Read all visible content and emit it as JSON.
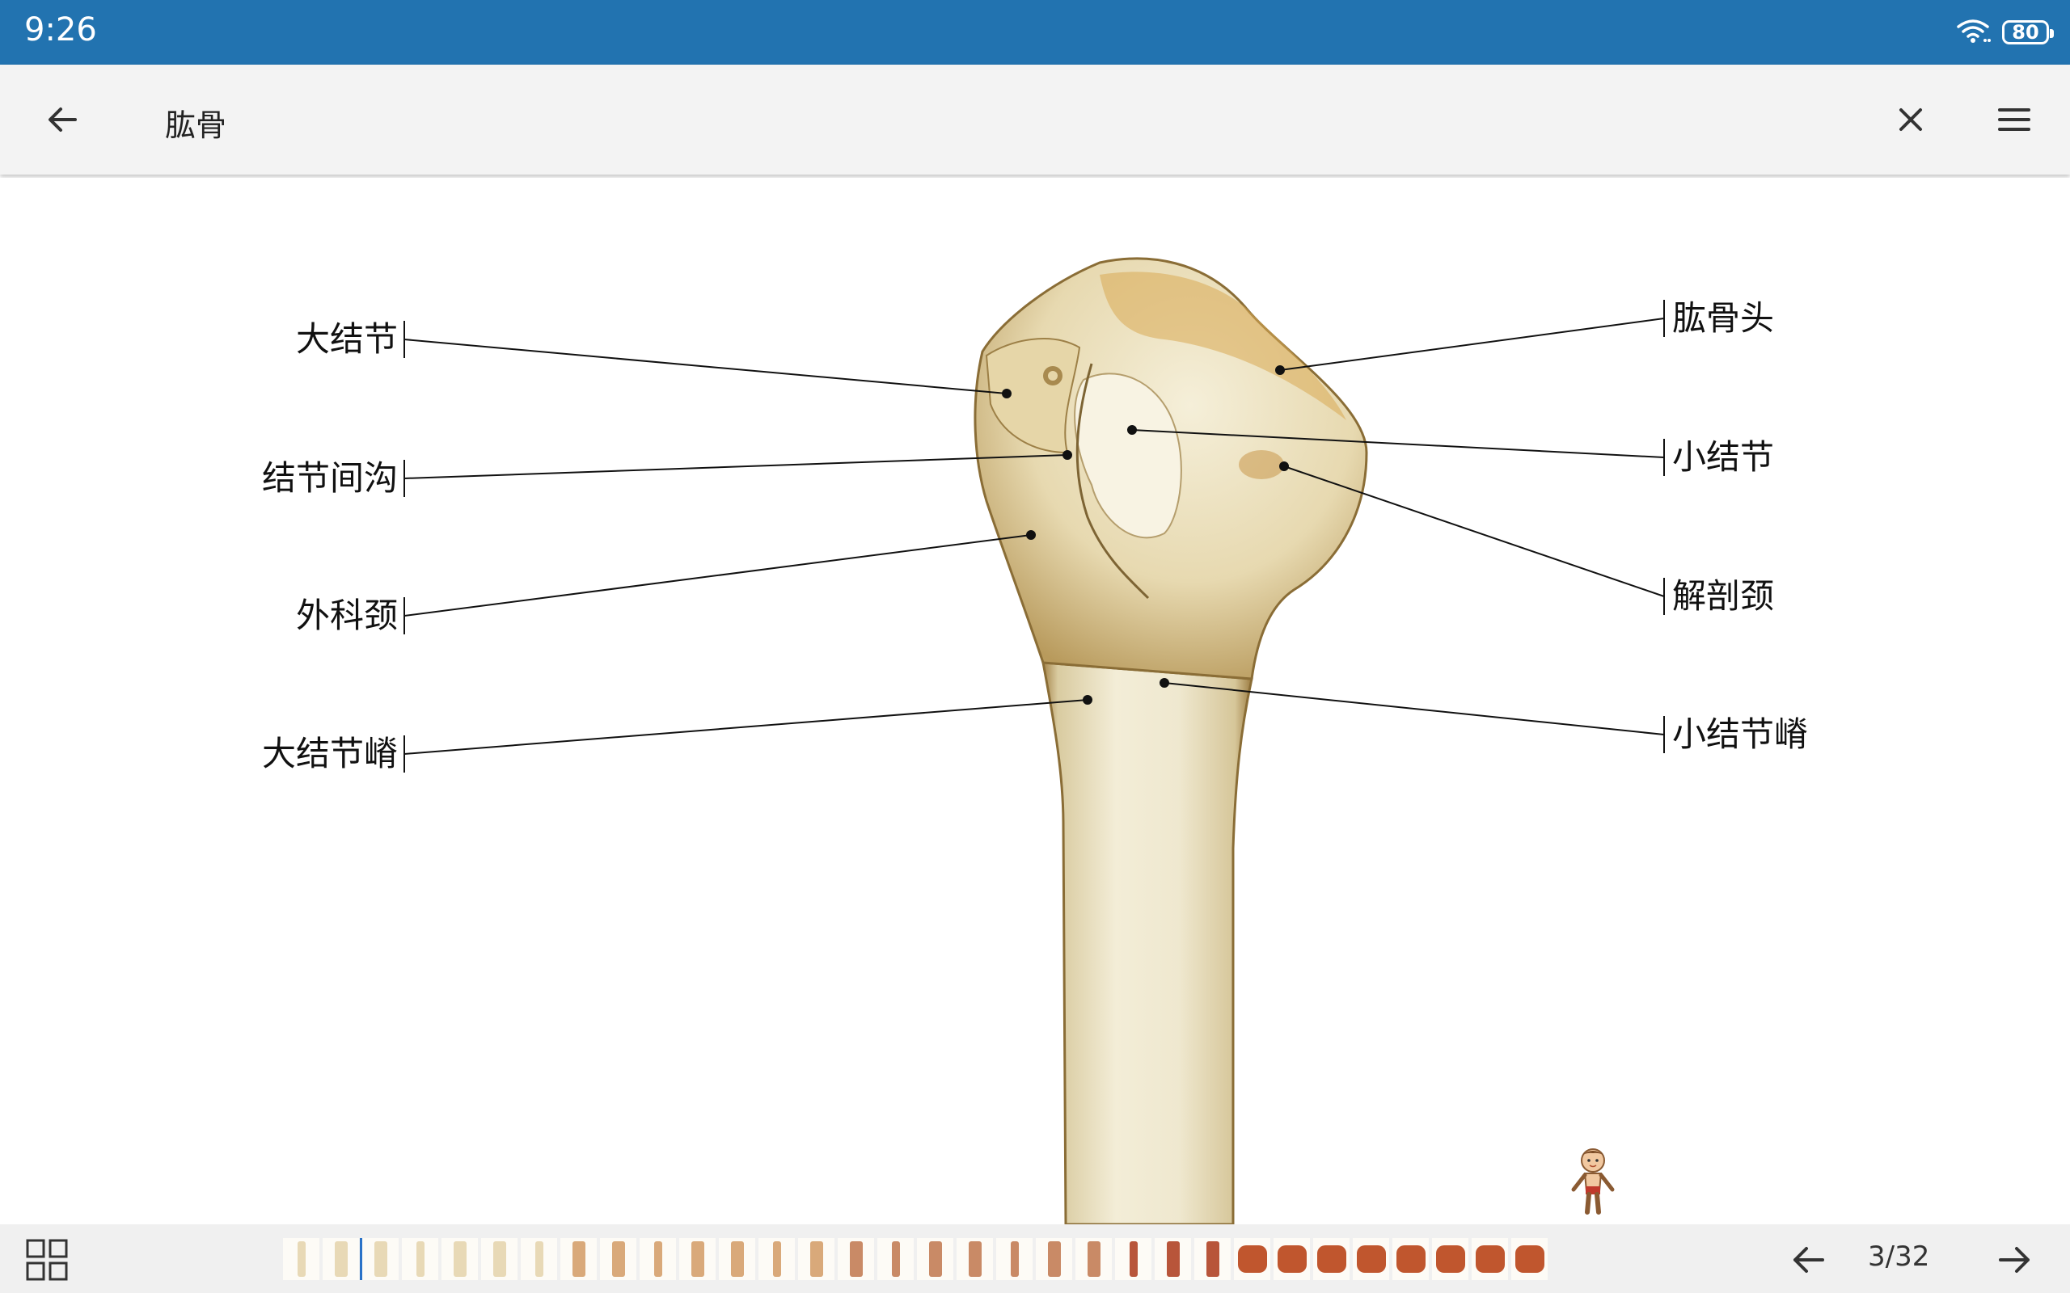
{
  "status": {
    "time": "9:26",
    "battery": "80"
  },
  "header": {
    "title": "肱骨",
    "back_icon": "arrow-left-icon",
    "close_icon": "close-icon",
    "menu_icon": "menu-icon"
  },
  "figure": {
    "left_labels": [
      "大结节",
      "结节间沟",
      "外科颈",
      "大结节嵴"
    ],
    "right_labels": [
      "肱骨头",
      "小结节",
      "解剖颈",
      "小结节嵴"
    ]
  },
  "bottom": {
    "page": "3/32",
    "grid_icon": "grid-icon",
    "prev_icon": "arrow-left-icon",
    "next_icon": "arrow-right-icon",
    "thumbnail_count": 32
  },
  "colors": {
    "status_bar": "#2273b0",
    "app_bar": "#f3f3f3",
    "bottom_bar": "#f0f0f0",
    "bone": "#efe8cf"
  }
}
